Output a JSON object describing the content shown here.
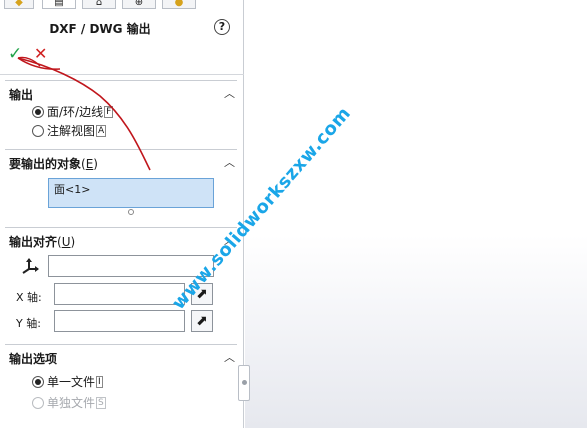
{
  "tabs": [
    {
      "icon": "feature-manager-icon",
      "glyph": "◆"
    },
    {
      "icon": "property-manager-icon",
      "glyph": "▤"
    },
    {
      "icon": "configuration-manager-icon",
      "glyph": "⌂"
    },
    {
      "icon": "dim-expert-icon",
      "glyph": "⊕"
    },
    {
      "icon": "display-manager-icon",
      "glyph": "●"
    }
  ],
  "panel": {
    "title": "DXF / DWG 输出",
    "help": "?",
    "ok_glyph": "✓",
    "cancel_glyph": "✕"
  },
  "output_group": {
    "title": "输出",
    "options": [
      {
        "label": "面/环/边线",
        "key": "F",
        "selected": true
      },
      {
        "label": "注解视图",
        "key": "A",
        "selected": false
      }
    ]
  },
  "entities_group": {
    "title": "要输出的对象",
    "title_key": "E",
    "items": [
      "面<1>"
    ]
  },
  "align_group": {
    "title": "输出对齐",
    "title_key": "U",
    "origin_value": "",
    "x_label": "X 轴:",
    "x_value": "",
    "y_label": "Y 轴:",
    "y_value": ""
  },
  "options_group": {
    "title": "输出选项",
    "options": [
      {
        "label": "单一文件",
        "key": "I",
        "selected": true,
        "disabled": false
      },
      {
        "label": "单独文件",
        "key": "S",
        "selected": false,
        "disabled": true
      }
    ]
  },
  "watermark": "www.solidworkszxw.com",
  "colors": {
    "accent": "#6aa3d8",
    "selection": "#cfe3f7",
    "ok": "#22a34a",
    "cancel": "#d02020",
    "annotation": "#c0161c",
    "watermark": "#1aa6e8"
  }
}
